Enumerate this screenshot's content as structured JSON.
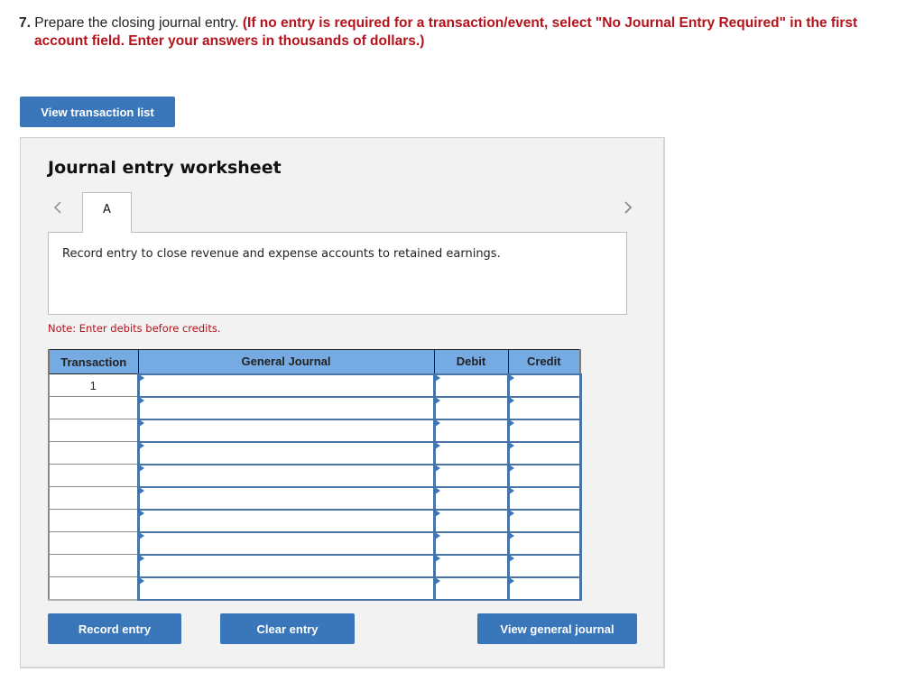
{
  "question": {
    "number": "7.",
    "prompt": "Prepare the closing journal entry.",
    "instruction_line1": "(If no entry is required for a transaction/event, select \"No Journal Entry Required\" in the first",
    "instruction_line2": "account field. Enter your answers in thousands of dollars.)"
  },
  "buttons": {
    "view_transaction_list": "View transaction list",
    "record_entry": "Record entry",
    "clear_entry": "Clear entry",
    "view_general_journal": "View general journal"
  },
  "worksheet": {
    "title": "Journal entry worksheet",
    "tabs": [
      {
        "label": "A",
        "active": true
      }
    ],
    "prev_icon": "chevron-left-icon",
    "next_icon": "chevron-right-icon",
    "description": "Record entry to close revenue and expense accounts to retained earnings.",
    "note": "Note: Enter debits before credits."
  },
  "journal": {
    "columns": [
      "Transaction",
      "General Journal",
      "Debit",
      "Credit"
    ],
    "rows": [
      {
        "transaction": "1",
        "account": "",
        "debit": "",
        "credit": ""
      },
      {
        "transaction": "",
        "account": "",
        "debit": "",
        "credit": ""
      },
      {
        "transaction": "",
        "account": "",
        "debit": "",
        "credit": ""
      },
      {
        "transaction": "",
        "account": "",
        "debit": "",
        "credit": ""
      },
      {
        "transaction": "",
        "account": "",
        "debit": "",
        "credit": ""
      },
      {
        "transaction": "",
        "account": "",
        "debit": "",
        "credit": ""
      },
      {
        "transaction": "",
        "account": "",
        "debit": "",
        "credit": ""
      },
      {
        "transaction": "",
        "account": "",
        "debit": "",
        "credit": ""
      },
      {
        "transaction": "",
        "account": "",
        "debit": "",
        "credit": ""
      },
      {
        "transaction": "",
        "account": "",
        "debit": "",
        "credit": ""
      }
    ]
  },
  "colors": {
    "accent": "#3a77ba",
    "header_fill": "#75aae3",
    "instruction_red": "#b5121b",
    "input_border": "#4a74a4",
    "panel_bg": "#f2f2f2"
  }
}
